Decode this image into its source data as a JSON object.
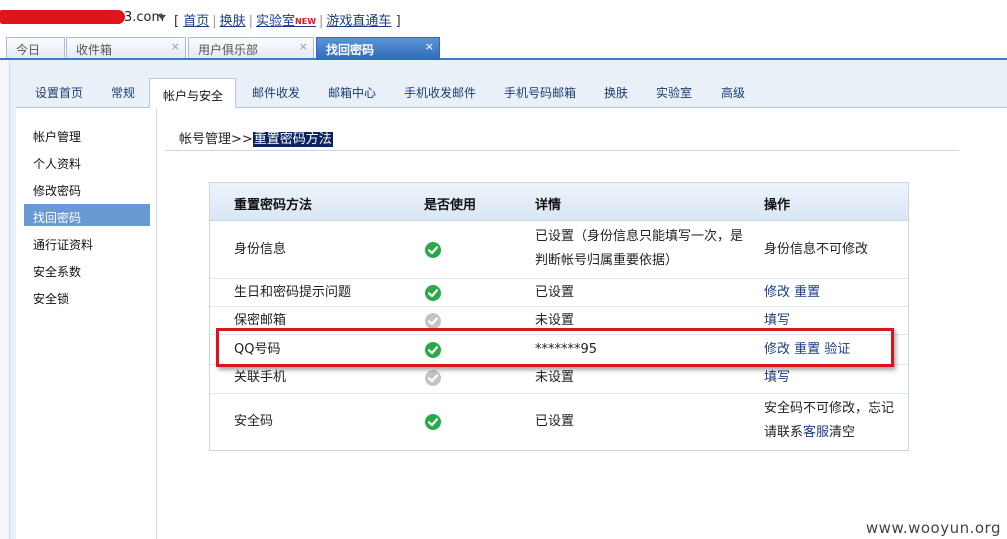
{
  "topbar": {
    "domain_suffix": "3.com",
    "links": [
      "首页",
      "换肤",
      "实验室",
      "游戏直通车"
    ],
    "new_badge": "NEW",
    "bracket_open": "[",
    "bracket_close": "]",
    "separator": "|"
  },
  "browser_tabs": [
    {
      "label": "今日"
    },
    {
      "label": "收件箱",
      "close": "×"
    },
    {
      "label": "用户俱乐部",
      "close": "×"
    },
    {
      "label": "找回密码",
      "close": "×",
      "active": true
    }
  ],
  "settings_tabs": [
    "设置首页",
    "常规",
    "帐户与安全",
    "邮件收发",
    "邮箱中心",
    "手机收发邮件",
    "手机号码邮箱",
    "换肤",
    "实验室",
    "高级"
  ],
  "sidebar": {
    "items": [
      "帐户管理",
      "个人资料",
      "修改密码",
      "找回密码",
      "通行证资料",
      "安全系数",
      "安全锁"
    ],
    "active_index": 3
  },
  "breadcrumb": {
    "prefix": "帐号管理>>",
    "current": "重置密码方法"
  },
  "table": {
    "headers": [
      "重置密码方法",
      "是否使用",
      "详情",
      "操作"
    ],
    "rows": [
      {
        "method": "身份信息",
        "enabled": true,
        "detail": "已设置（身份信息只能填写一次，是判断帐号归属重要依据）",
        "op_text": "身份信息不可修改",
        "op_links": []
      },
      {
        "method": "生日和密码提示问题",
        "enabled": true,
        "detail": "已设置",
        "op_text": "",
        "op_links": [
          "修改",
          "重置"
        ]
      },
      {
        "method": "保密邮箱",
        "enabled": false,
        "detail": "未设置",
        "op_text": "",
        "op_links": [
          "填写"
        ]
      },
      {
        "method": "QQ号码",
        "enabled": true,
        "detail": "*******95",
        "op_text": "",
        "op_links": [
          "修改",
          "重置",
          "验证"
        ]
      },
      {
        "method": "关联手机",
        "enabled": false,
        "detail": "未设置",
        "op_text": "",
        "op_links": [
          "填写"
        ]
      },
      {
        "method": "安全码",
        "enabled": true,
        "detail": "已设置",
        "op_text_1": "安全码不可修改，忘记",
        "op_text_2a": "请联系",
        "op_link": "客服",
        "op_text_2b": "清空"
      }
    ]
  },
  "highlight_color": "#d8141e",
  "accent_color": "#3d7ac8",
  "watermark": "www.wooyun.org"
}
